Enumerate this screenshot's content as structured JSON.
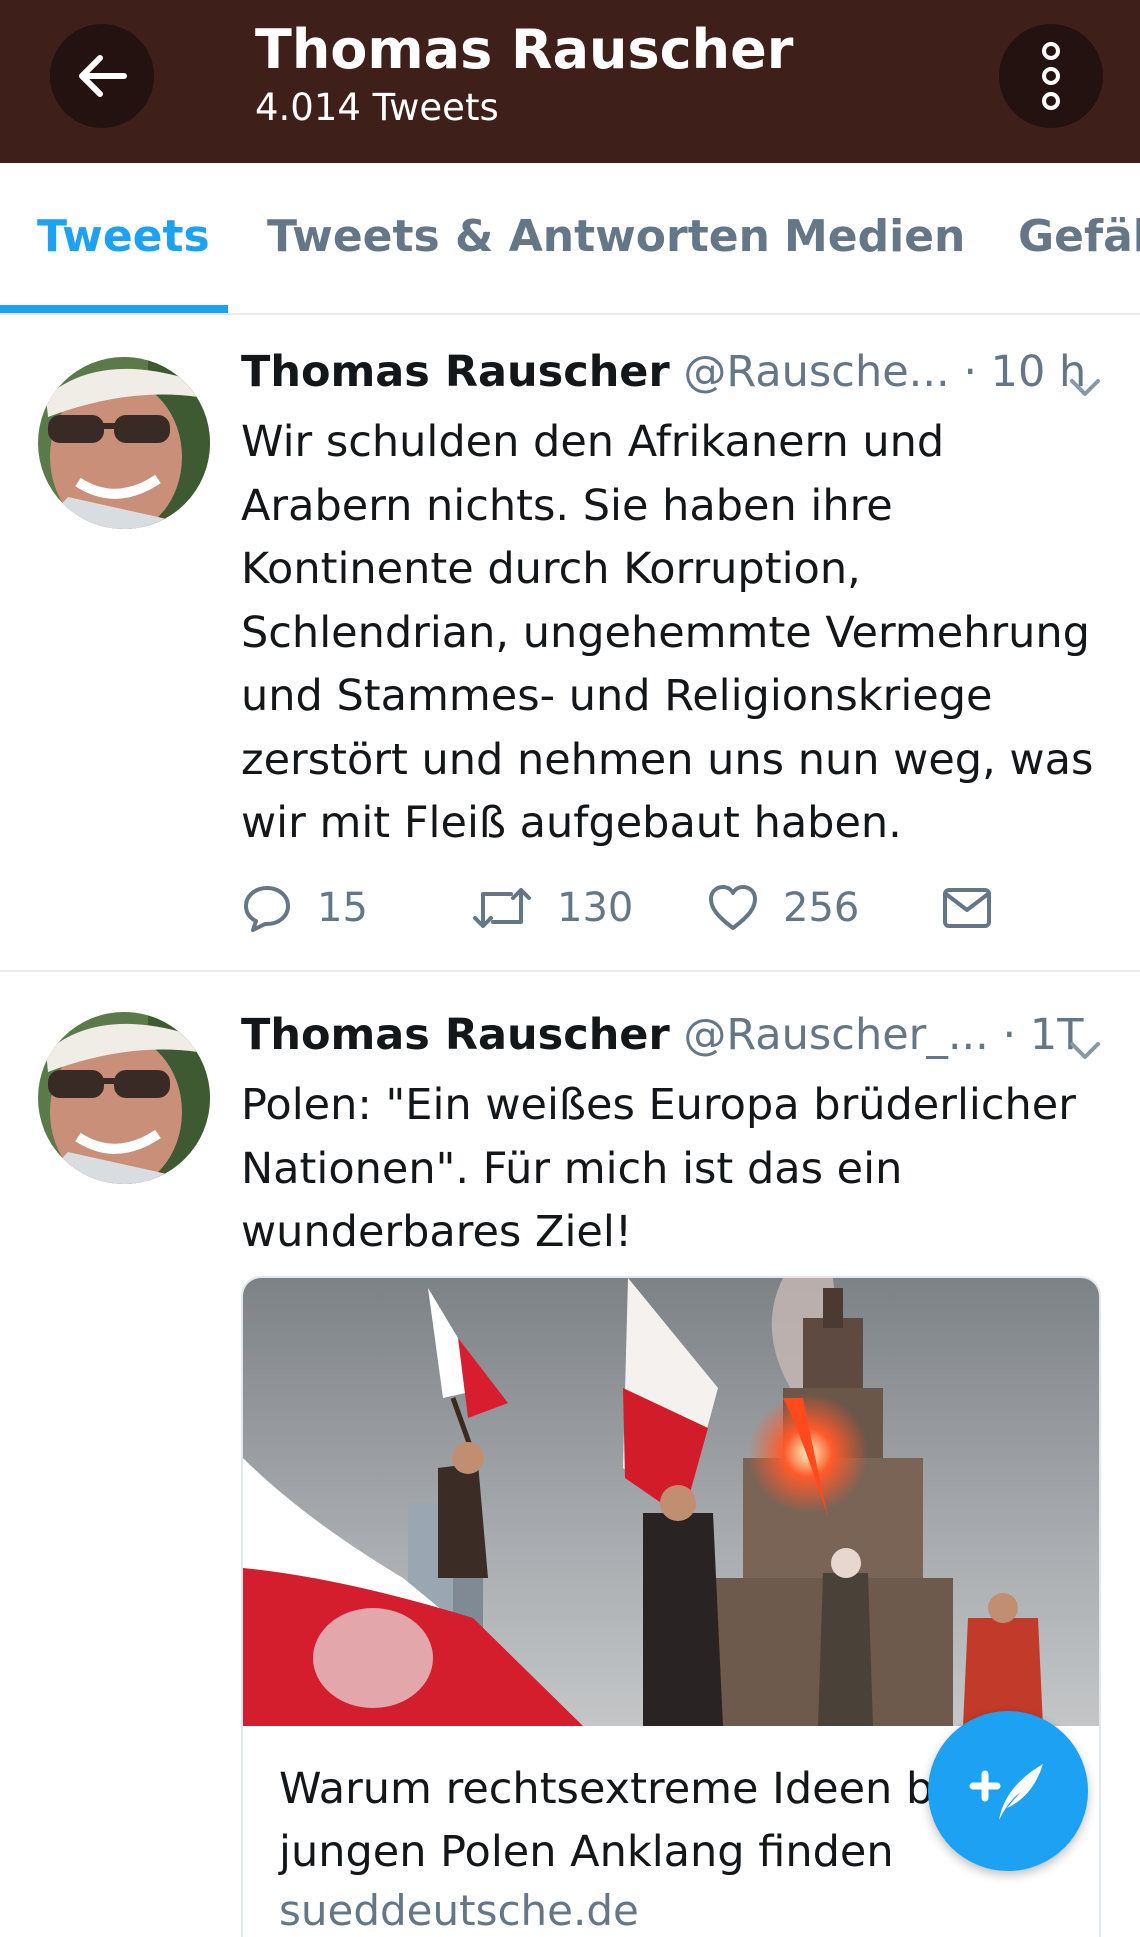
{
  "header": {
    "title": "Thomas Rauscher",
    "subtitle": "4.014 Tweets",
    "background": "#3e1f1a"
  },
  "tabs": [
    {
      "label": "Tweets",
      "active": true
    },
    {
      "label": "Tweets & Antworten",
      "active": false
    },
    {
      "label": "Medien",
      "active": false
    },
    {
      "label": "Gefäll",
      "active": false
    }
  ],
  "tweets": [
    {
      "name": "Thomas Rauscher",
      "handle": "@Rausche...",
      "separator": "·",
      "time": "10 h",
      "lines": [
        "Wir schulden den Afrikanern und",
        "Arabern nichts. Sie haben ihre",
        "Kontinente durch Korruption,",
        "Schlendrian, ungehemmte Vermehrung",
        "und Stammes- und Religionskriege",
        "zerstört und nehmen uns nun weg, was",
        "wir mit Fleiß aufgebaut haben."
      ],
      "replies": "15",
      "retweets": "130",
      "likes": "256"
    },
    {
      "name": "Thomas Rauscher",
      "handle": "@Rauscher_...",
      "separator": "·",
      "time": "1T",
      "lines": [
        "Polen: \"Ein weißes Europa brüderlicher",
        "Nationen\". Für mich ist das ein",
        "wunderbares Ziel!"
      ],
      "card": {
        "title_lines": [
          "Warum rechtsextreme Ideen b",
          "jungen Polen Anklang finden"
        ],
        "domain": "sueddeutsche.de"
      }
    }
  ],
  "icons": {
    "back": "arrow-left-icon",
    "more": "more-vertical-icon",
    "reply": "reply-icon",
    "retweet": "retweet-icon",
    "like": "heart-icon",
    "dm": "envelope-icon",
    "compose": "compose-quill-icon"
  },
  "colors": {
    "accent": "#1da1f2",
    "secondary_text": "#657786",
    "primary_text": "#14171a"
  }
}
